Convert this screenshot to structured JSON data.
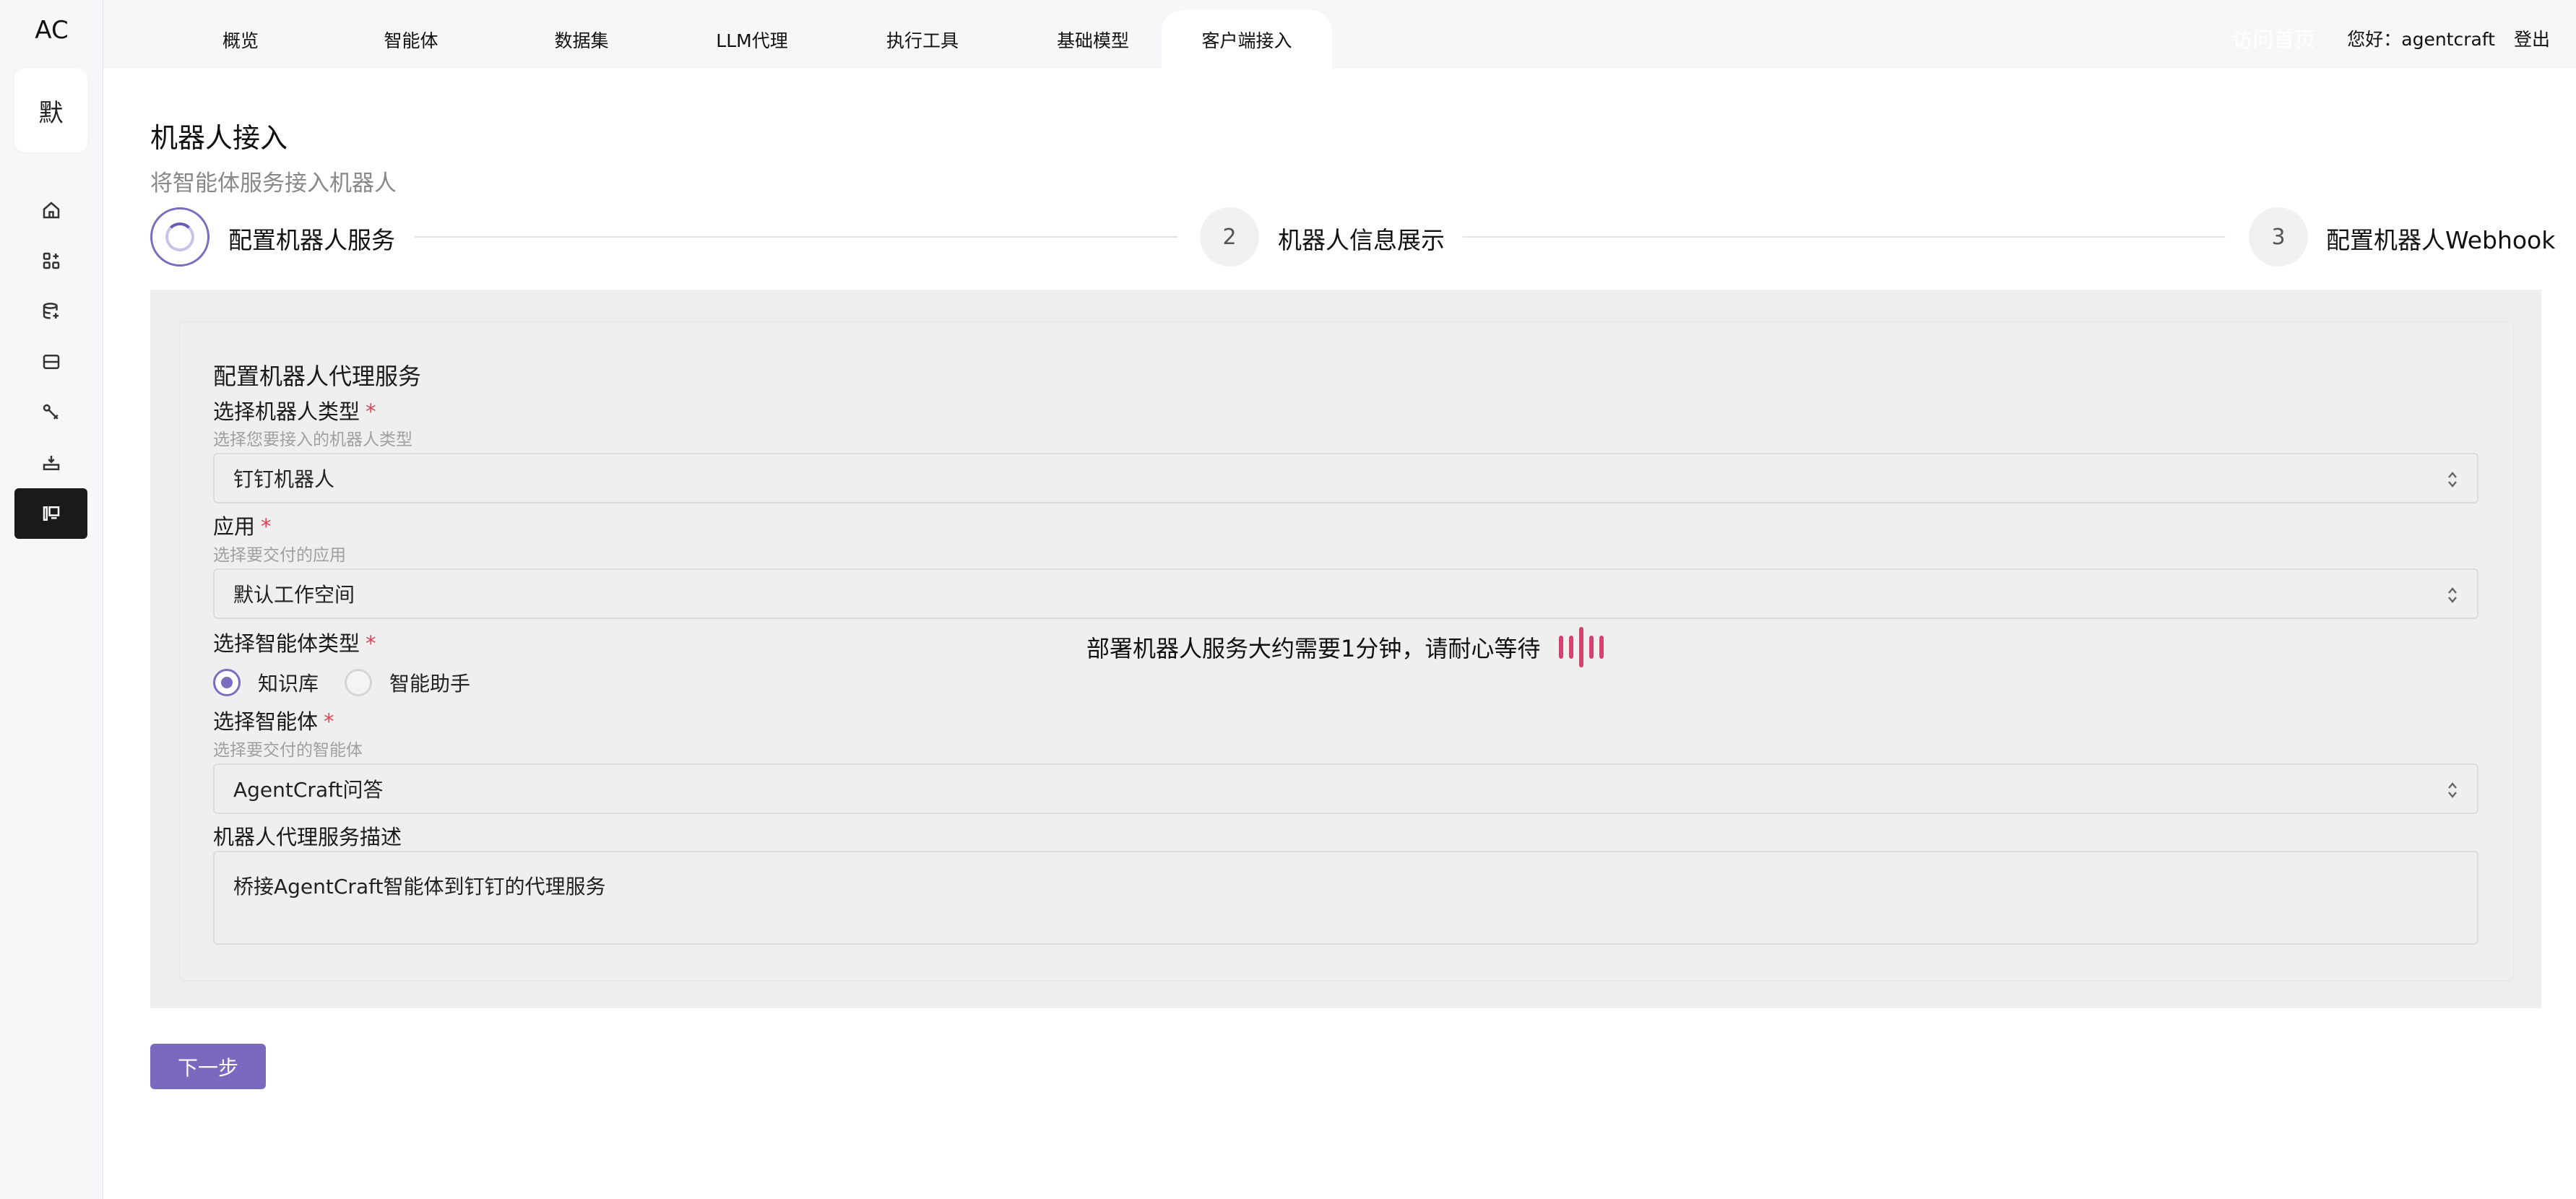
{
  "app": {
    "logo": "AC",
    "workspace_initial": "默"
  },
  "sidebar": {
    "items": [
      {
        "icon": "home-icon"
      },
      {
        "icon": "agents-grid-icon"
      },
      {
        "icon": "dataset-icon"
      },
      {
        "icon": "llm-proxy-icon"
      },
      {
        "icon": "tools-icon"
      },
      {
        "icon": "model-icon"
      },
      {
        "icon": "client-access-icon",
        "active": true
      }
    ]
  },
  "topbar": {
    "tabs": [
      {
        "label": "概览"
      },
      {
        "label": "智能体"
      },
      {
        "label": "数据集"
      },
      {
        "label": "LLM代理"
      },
      {
        "label": "执行工具"
      },
      {
        "label": "基础模型"
      },
      {
        "label": "客户端接入",
        "active": true
      }
    ],
    "hidden_text": "访问首页",
    "greeting": "您好：agentcraft",
    "logout": "登出"
  },
  "page": {
    "title": "机器人接入",
    "subtitle": "将智能体服务接入机器人"
  },
  "steps": [
    {
      "number": "1",
      "label": "配置机器人服务",
      "status": "in-progress"
    },
    {
      "number": "2",
      "label": "机器人信息展示",
      "status": "waiting"
    },
    {
      "number": "3",
      "label": "配置机器人Webhook",
      "status": "waiting"
    }
  ],
  "form": {
    "section_title": "配置机器人代理服务",
    "required_mark": "*",
    "robot_type": {
      "label": "选择机器人类型",
      "help": "选择您要接入的机器人类型",
      "value": "钉钉机器人"
    },
    "app": {
      "label": "应用",
      "help": "选择要交付的应用",
      "value": "默认工作空间"
    },
    "agent_type": {
      "label": "选择智能体类型",
      "options": [
        {
          "label": "知识库",
          "checked": true
        },
        {
          "label": "智能助手",
          "checked": false
        }
      ]
    },
    "agent": {
      "label": "选择智能体",
      "help": "选择要交付的智能体",
      "value": "AgentCraft问答"
    },
    "description": {
      "label": "机器人代理服务描述",
      "value": "桥接AgentCraft智能体到钉钉的代理服务"
    }
  },
  "loading": {
    "text": "部署机器人服务大约需要1分钟，请耐心等待"
  },
  "actions": {
    "next": "下一步"
  },
  "colors": {
    "accent": "#7a69be",
    "loader": "#d6426e",
    "required": "#e0445a",
    "active_nav": "#1a1a1a"
  }
}
